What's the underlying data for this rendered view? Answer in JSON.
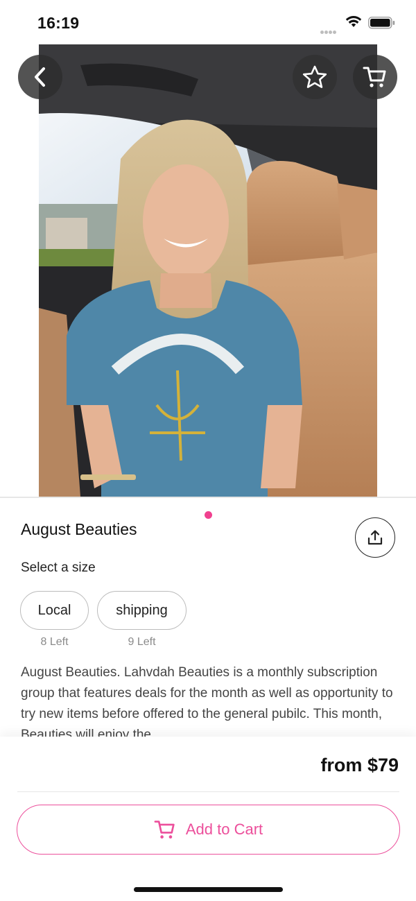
{
  "status_bar": {
    "time": "16:19"
  },
  "hero": {
    "page_indicator": {
      "current": 1,
      "total": 1
    }
  },
  "product": {
    "title": "August Beauties",
    "select_size_label": "Select a size",
    "sizes": [
      {
        "label": "Local",
        "stock": "8 Left"
      },
      {
        "label": "shipping",
        "stock": "9 Left"
      }
    ],
    "description": "August Beauties. Lahvdah Beauties is a monthly subscription group that features deals for the month as well as opportunity to try new items before offered to the general pubilc. This month, Beauties will enjoy the"
  },
  "footer": {
    "price": "from $79",
    "add_to_cart_label": "Add to Cart"
  },
  "icons": {
    "back": "chevron-left-icon",
    "favorite": "star-icon",
    "cart": "cart-icon",
    "share": "share-icon"
  },
  "colors": {
    "accent": "#ec4f9b",
    "indicator": "#f0418f",
    "overlay_button": "#2d2d2d"
  }
}
